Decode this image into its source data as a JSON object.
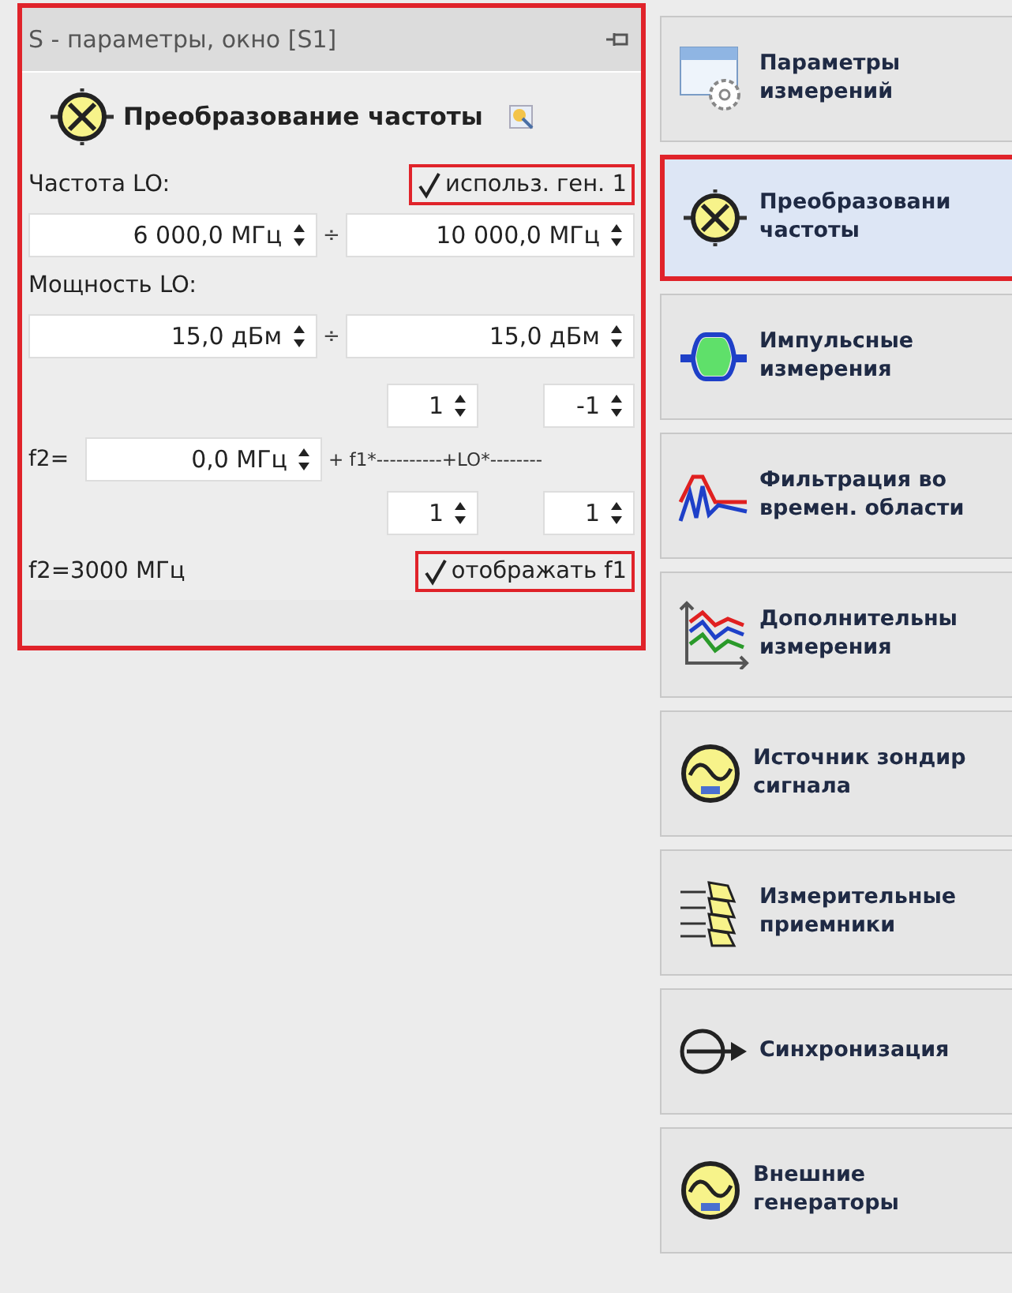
{
  "panel": {
    "title": "S - параметры, окно [S1]",
    "highlighted": true,
    "header": "Преобразование частоты",
    "lo_frequency": {
      "label": "Частота LO:",
      "checkbox": {
        "label": "использ. ген. 1",
        "checked": true,
        "highlighted": true
      },
      "from": "6 000,0  МГц",
      "separator": "÷",
      "to": "10 000,0  МГц"
    },
    "lo_power": {
      "label": "Мощность LO:",
      "from": "15,0 дБм",
      "separator": "÷",
      "to": "15,0 дБм"
    },
    "formula": {
      "label": "f2=",
      "offset": "0,0 МГц",
      "terms": "+ f1*----------+LO*--------",
      "f1_numerator": "1",
      "f1_denominator": "1",
      "lo_numerator": "-1",
      "lo_denominator": "1"
    },
    "result": "f2=3000 МГц",
    "show_f1": {
      "label": "отображать f1",
      "checked": true,
      "highlighted": true
    }
  },
  "nav": [
    {
      "kind": "settings",
      "label": "Параметры\nизмерений",
      "selected": false
    },
    {
      "kind": "mixer",
      "label": "Преобразовани\nчастоты",
      "selected": true
    },
    {
      "kind": "pulse",
      "label": "Импульсные\nизмерения",
      "selected": false
    },
    {
      "kind": "filter",
      "label": "Фильтрация во\nвремен. области",
      "selected": false
    },
    {
      "kind": "chart",
      "label": "Дополнительны\nизмерения",
      "selected": false
    },
    {
      "kind": "source",
      "label": "Источник зондир\nсигнала",
      "selected": false
    },
    {
      "kind": "receivers",
      "label": "Измерительные\nприемники",
      "selected": false
    },
    {
      "kind": "sync",
      "label": "Синхронизация",
      "selected": false
    },
    {
      "kind": "generator",
      "label": "Внешние\nгенераторы",
      "selected": false
    }
  ]
}
